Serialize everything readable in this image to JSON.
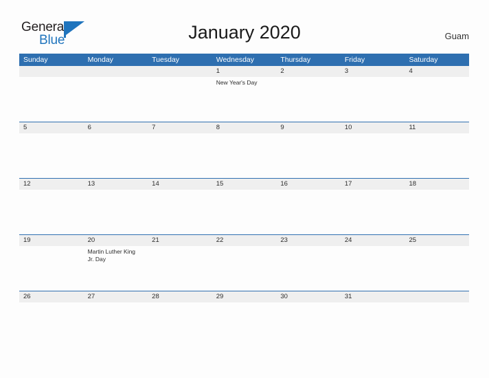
{
  "brand": {
    "name_part1": "General",
    "name_part2": "Blue",
    "accent_color": "#1f74bd"
  },
  "header": {
    "title": "January 2020",
    "location": "Guam"
  },
  "calendar": {
    "header_bg": "#2e6fb0",
    "date_band_bg": "#efefef",
    "day_names": [
      "Sunday",
      "Monday",
      "Tuesday",
      "Wednesday",
      "Thursday",
      "Friday",
      "Saturday"
    ],
    "weeks": [
      {
        "dates": [
          "",
          "",
          "",
          "1",
          "2",
          "3",
          "4"
        ],
        "events": [
          "",
          "",
          "",
          "New Year's Day",
          "",
          "",
          ""
        ]
      },
      {
        "dates": [
          "5",
          "6",
          "7",
          "8",
          "9",
          "10",
          "11"
        ],
        "events": [
          "",
          "",
          "",
          "",
          "",
          "",
          ""
        ]
      },
      {
        "dates": [
          "12",
          "13",
          "14",
          "15",
          "16",
          "17",
          "18"
        ],
        "events": [
          "",
          "",
          "",
          "",
          "",
          "",
          ""
        ]
      },
      {
        "dates": [
          "19",
          "20",
          "21",
          "22",
          "23",
          "24",
          "25"
        ],
        "events": [
          "",
          "Martin Luther King\nJr. Day",
          "",
          "",
          "",
          "",
          ""
        ]
      },
      {
        "dates": [
          "26",
          "27",
          "28",
          "29",
          "30",
          "31",
          ""
        ],
        "events": [
          "",
          "",
          "",
          "",
          "",
          "",
          ""
        ]
      }
    ]
  }
}
